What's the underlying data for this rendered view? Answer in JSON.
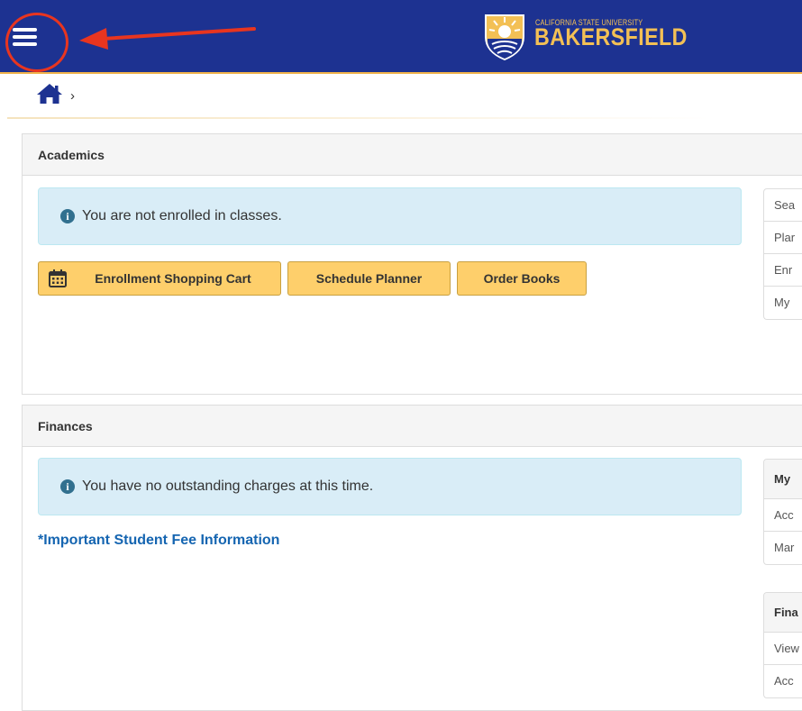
{
  "header": {
    "menu_icon": "hamburger-menu-icon",
    "logo_small": "CALIFORNIA STATE UNIVERSITY",
    "logo_big": "BAKERSFIELD",
    "colors": {
      "bar": "#1d3291",
      "gold": "#f3c055",
      "annotation": "#e8351f"
    }
  },
  "breadcrumb": {
    "home_icon": "home-icon",
    "separator": "›"
  },
  "academics": {
    "title": "Academics",
    "alert": "You are not enrolled in classes.",
    "buttons": {
      "shopping_cart": "Enrollment Shopping Cart",
      "schedule_planner": "Schedule Planner",
      "order_books": "Order Books"
    },
    "side_items": [
      "Sea",
      "Plar",
      "Enr",
      "My"
    ]
  },
  "finances": {
    "title": "Finances",
    "alert": "You have no outstanding charges at this time.",
    "fee_link": "*Important Student Fee Information",
    "side_group1": {
      "title": "My",
      "items": [
        "Acc",
        "Mar"
      ]
    },
    "side_group2": {
      "title": "Fina",
      "items": [
        "View",
        "Acc"
      ]
    }
  }
}
